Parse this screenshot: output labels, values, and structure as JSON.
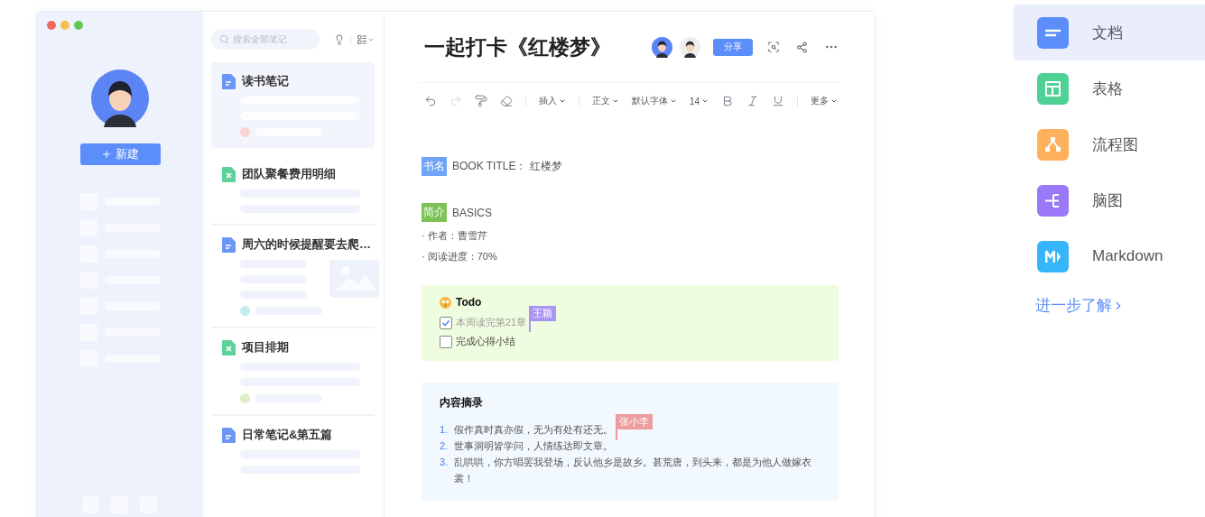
{
  "sidebar": {
    "new_button": "新建"
  },
  "note_list": {
    "search": {
      "placeholder": "搜索全部笔记"
    },
    "notes": [
      {
        "title": "读书笔记",
        "kind": "doc",
        "selected": true,
        "color": "#fbd3d3",
        "has_picture": false
      },
      {
        "title": "团队聚餐费用明细",
        "kind": "sheet",
        "selected": false,
        "has_picture": false
      },
      {
        "title": "周六的时候提醒要去爬…",
        "kind": "doc",
        "selected": false,
        "color": "#c2ecee",
        "has_picture": true
      },
      {
        "title": "项目排期",
        "kind": "sheet",
        "selected": false,
        "color": "#dcefc6",
        "has_picture": false
      },
      {
        "title": "日常笔记&第五篇",
        "kind": "doc",
        "selected": false,
        "has_picture": false
      }
    ]
  },
  "editor": {
    "title": "一起打卡《红楼梦》",
    "share_button": "分享",
    "toolbar": [
      {
        "kind": "undo",
        "disabled": false
      },
      {
        "kind": "redo",
        "disabled": true
      },
      {
        "kind": "painter",
        "disabled": false
      },
      {
        "kind": "eraser",
        "disabled": false
      },
      {
        "kind": "separator"
      },
      {
        "kind": "dropdown",
        "label": "插入"
      },
      {
        "kind": "separator"
      },
      {
        "kind": "dropdown",
        "label": "正文"
      },
      {
        "kind": "dropdown",
        "label": "默认字体"
      },
      {
        "kind": "dropdown",
        "label": "14"
      },
      {
        "kind": "bold",
        "disabled": false
      },
      {
        "kind": "italic",
        "disabled": false
      },
      {
        "kind": "underline",
        "disabled": false
      },
      {
        "kind": "separator"
      },
      {
        "kind": "dropdown",
        "label": "更多"
      }
    ],
    "fields": [
      {
        "tag": "书名",
        "color": "#6fa3f7",
        "text": "BOOK TITLE： 红楼梦"
      },
      {
        "tag": "简介",
        "color": "#7dc257",
        "text": "BASICS",
        "bullets": [
          "· 作者：曹雪芹",
          "· 阅读进度：70%"
        ]
      }
    ],
    "todo": {
      "title": "Todo",
      "items": [
        {
          "text": "本周读完第21章",
          "checked": true,
          "cursor": {
            "name": "王颖",
            "color": "#a995f2"
          }
        },
        {
          "text": "完成心得小结",
          "checked": false
        }
      ]
    },
    "excerpt": {
      "title": "内容摘录",
      "items": [
        {
          "number": "1.",
          "text": "假作真时真亦假，无为有处有还无。",
          "cursor": {
            "name": "张小李",
            "color": "#ec9c9c"
          }
        },
        {
          "number": "2.",
          "text": "世事洞明皆学问，人情练达即文章。"
        },
        {
          "number": "3.",
          "text": "乱哄哄，你方唱罢我登场，反认他乡是故乡。甚荒唐，到头来，都是为他人做嫁衣裳！"
        }
      ]
    }
  },
  "types": {
    "items": [
      {
        "label": "文档",
        "kind": "doc",
        "selected": true
      },
      {
        "label": "表格",
        "kind": "sheet",
        "selected": false
      },
      {
        "label": "流程图",
        "kind": "flow",
        "selected": false
      },
      {
        "label": "脑图",
        "kind": "mind",
        "selected": false
      },
      {
        "label": "Markdown",
        "kind": "markdown",
        "selected": false
      }
    ],
    "link": "进一步了解"
  }
}
